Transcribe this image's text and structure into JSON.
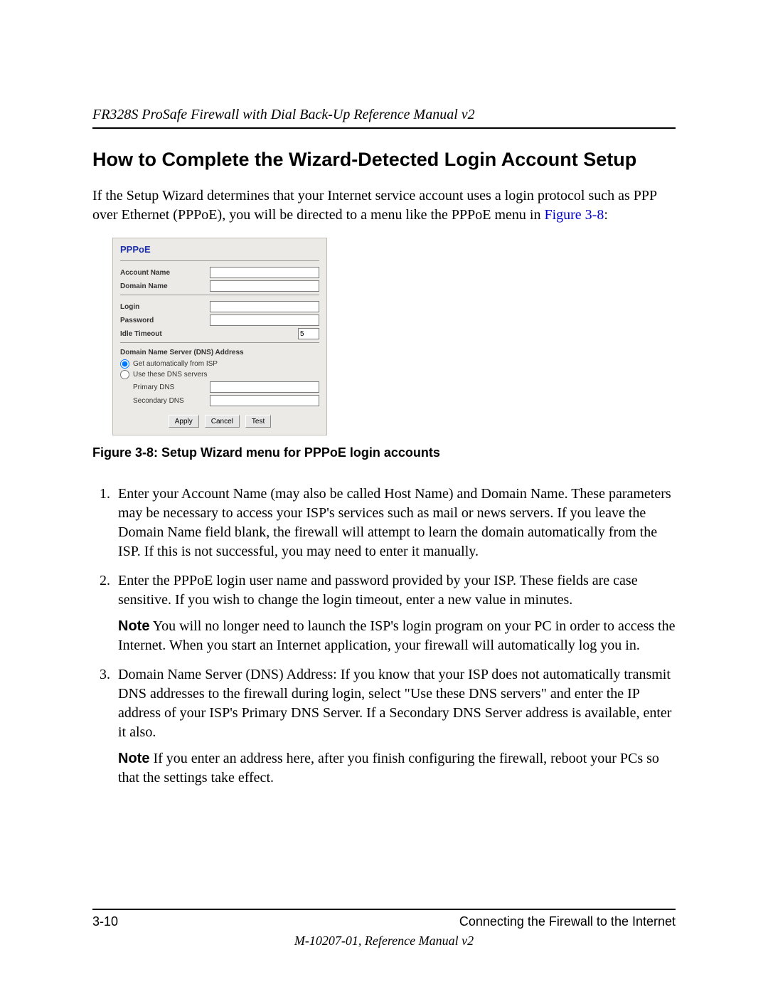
{
  "header": {
    "running": "FR328S ProSafe Firewall with Dial Back-Up Reference Manual v2"
  },
  "section": {
    "title": "How to Complete the Wizard-Detected Login Account Setup",
    "intro_a": "If the Setup Wizard determines that your Internet service account uses a login protocol such as PPP over Ethernet (PPPoE), you will be directed to a menu like the PPPoE menu in ",
    "xref": "Figure 3-8",
    "intro_b": ":"
  },
  "screenshot": {
    "title": "PPPoE",
    "account_name_lbl": "Account Name",
    "domain_name_lbl": "Domain Name",
    "login_lbl": "Login",
    "password_lbl": "Password",
    "idle_lbl": "Idle Timeout",
    "idle_value": "5",
    "dns_section": "Domain Name Server (DNS) Address",
    "radio_auto": "Get automatically from ISP",
    "radio_manual": "Use these DNS servers",
    "primary_lbl": "Primary DNS",
    "secondary_lbl": "Secondary DNS",
    "apply": "Apply",
    "cancel": "Cancel",
    "test": "Test"
  },
  "caption": "Figure 3-8: Setup Wizard menu for PPPoE login accounts",
  "steps": {
    "s1": "Enter your Account Name (may also be called Host Name) and Domain Name. These parameters may be necessary to access your ISP's services such as mail or news servers. If you leave the Domain Name field blank, the firewall will attempt to learn the domain automatically from the ISP. If this is not successful, you may need to enter it manually.",
    "s2": "Enter the PPPoE login user name and password provided by your ISP. These fields are case sensitive. If you wish to change the login timeout, enter a new value in minutes.",
    "s2_note_label": "Note",
    "s2_note": "  You will no longer need to launch the ISP's login program on your PC in order to access the Internet. When you start an Internet application, your firewall will automatically log you in.",
    "s3": "Domain Name Server (DNS) Address: If you know that your ISP does not automatically transmit DNS addresses to the firewall during login, select \"Use these DNS servers\" and enter the IP address of your ISP's Primary DNS Server. If a Secondary DNS Server address is available, enter it also.",
    "s3_note_label": "Note",
    "s3_note": "  If you enter an address here, after you finish configuring the firewall, reboot your PCs so that the settings take effect."
  },
  "footer": {
    "page": "3-10",
    "chapter": "Connecting the Firewall to the Internet",
    "docid": "M-10207-01, Reference Manual v2"
  }
}
